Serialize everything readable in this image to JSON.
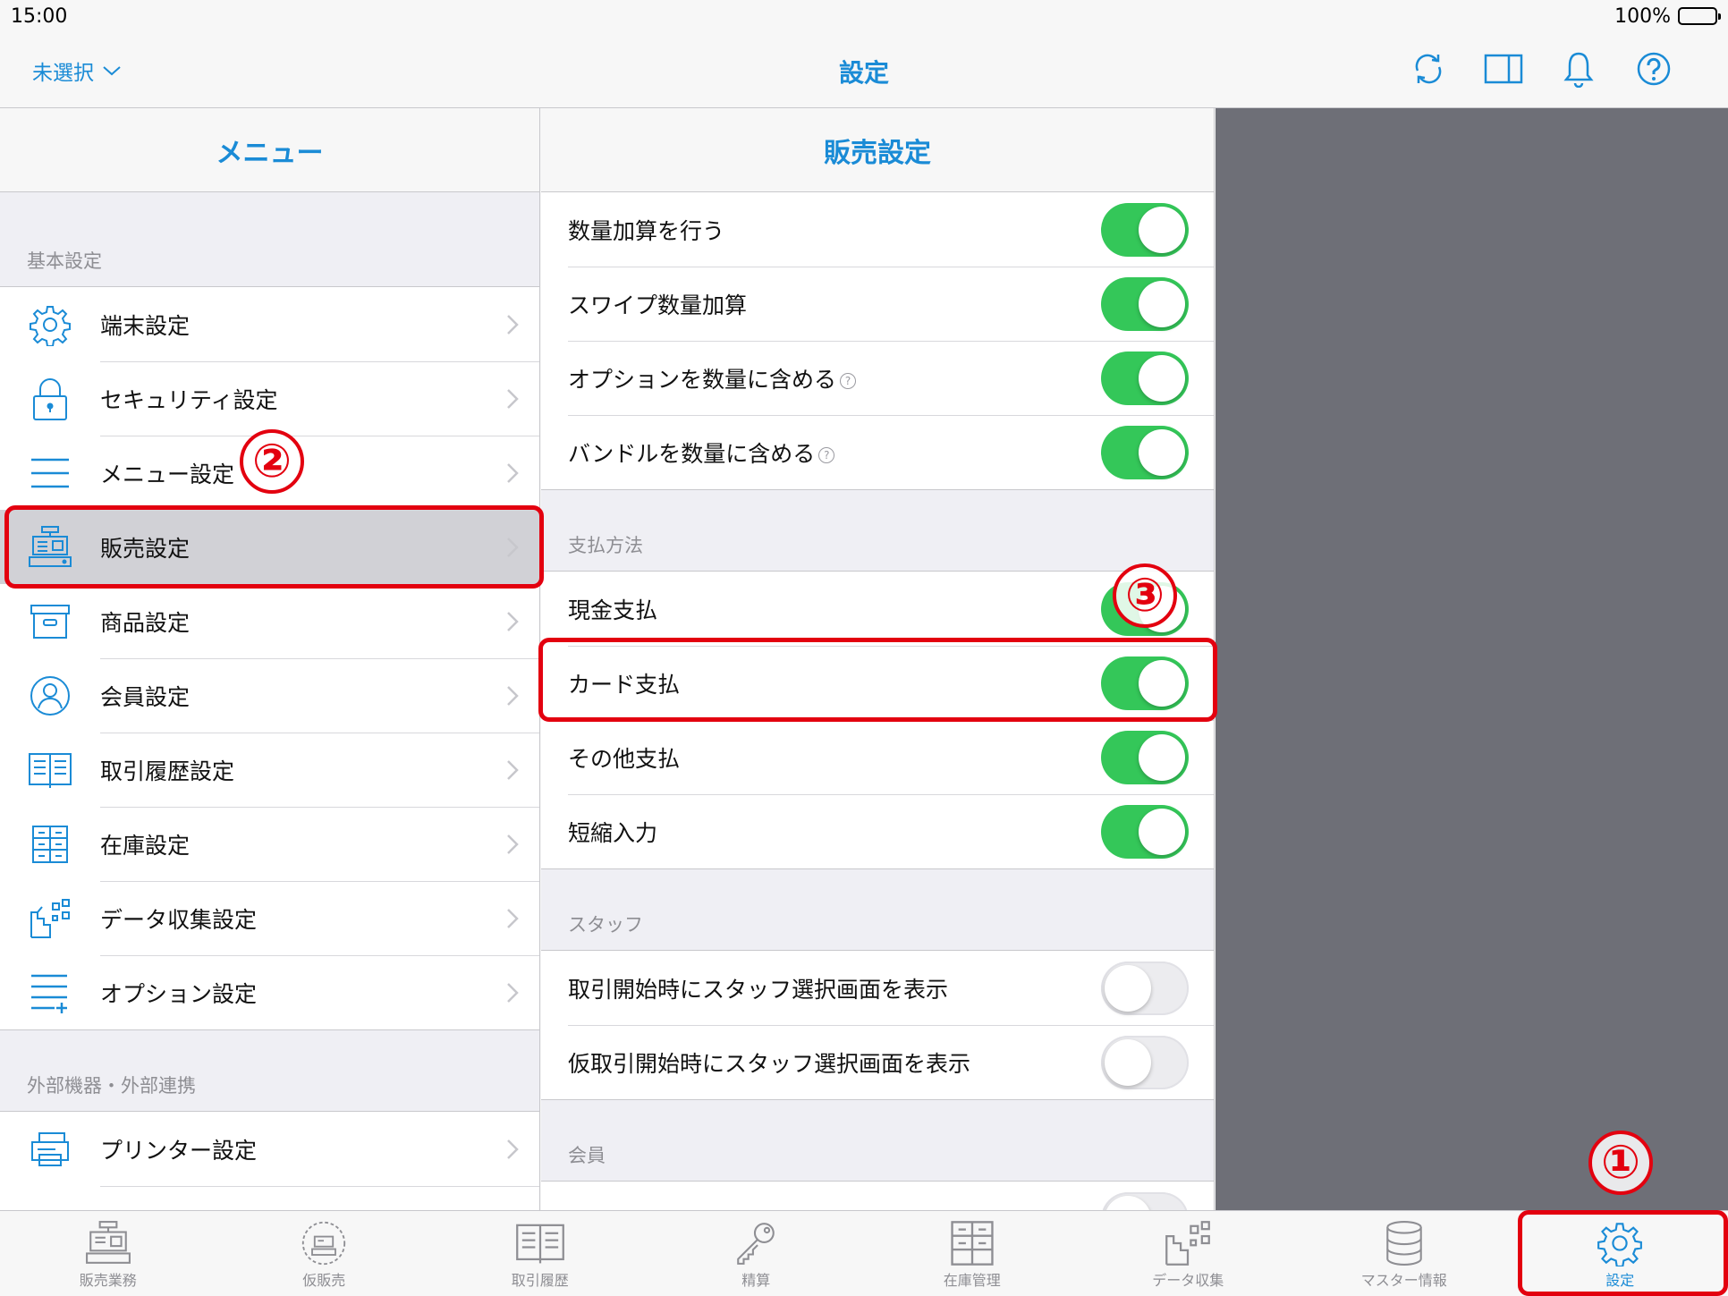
{
  "status_bar": {
    "time": "15:00",
    "battery": "100%"
  },
  "nav_bar": {
    "left_label": "未選択",
    "title": "設定",
    "icons": [
      "refresh-icon",
      "split-view-icon",
      "bell-icon",
      "help-icon"
    ]
  },
  "menu": {
    "title": "メニュー",
    "sections": [
      {
        "header": "基本設定",
        "items": [
          {
            "label": "端末設定",
            "icon": "gear-icon"
          },
          {
            "label": "セキュリティ設定",
            "icon": "lock-icon"
          },
          {
            "label": "メニュー設定",
            "icon": "list-icon"
          },
          {
            "label": "販売設定",
            "icon": "register-icon"
          },
          {
            "label": "商品設定",
            "icon": "box-icon"
          },
          {
            "label": "会員設定",
            "icon": "person-icon"
          },
          {
            "label": "取引履歴設定",
            "icon": "book-icon"
          },
          {
            "label": "在庫設定",
            "icon": "cabinet-icon"
          },
          {
            "label": "データ収集設定",
            "icon": "data-collect-icon"
          },
          {
            "label": "オプション設定",
            "icon": "list-plus-icon"
          }
        ]
      },
      {
        "header": "外部機器・外部連携",
        "items": [
          {
            "label": "プリンター設定",
            "icon": "printer-icon"
          }
        ]
      }
    ]
  },
  "detail": {
    "title": "販売設定",
    "groups": [
      {
        "header": "",
        "rows": [
          {
            "label": "数量加算を行う",
            "on": true,
            "help": false
          },
          {
            "label": "スワイプ数量加算",
            "on": true,
            "help": false
          },
          {
            "label": "オプションを数量に含める",
            "on": true,
            "help": true
          },
          {
            "label": "バンドルを数量に含める",
            "on": true,
            "help": true
          }
        ]
      },
      {
        "header": "支払方法",
        "rows": [
          {
            "label": "現金支払",
            "on": true,
            "help": false
          },
          {
            "label": "カード支払",
            "on": true,
            "help": false
          },
          {
            "label": "その他支払",
            "on": true,
            "help": false
          },
          {
            "label": "短縮入力",
            "on": true,
            "help": false
          }
        ]
      },
      {
        "header": "スタッフ",
        "rows": [
          {
            "label": "取引開始時にスタッフ選択画面を表示",
            "on": false,
            "help": false
          },
          {
            "label": "仮取引開始時にスタッフ選択画面を表示",
            "on": false,
            "help": false
          }
        ]
      },
      {
        "header": "会員",
        "rows": []
      }
    ]
  },
  "tab_bar": {
    "tabs": [
      {
        "label": "販売業務",
        "icon": "register-icon"
      },
      {
        "label": "仮販売",
        "icon": "temp-register-icon"
      },
      {
        "label": "取引履歴",
        "icon": "book-icon"
      },
      {
        "label": "精算",
        "icon": "key-icon"
      },
      {
        "label": "在庫管理",
        "icon": "cabinet-icon"
      },
      {
        "label": "データ収集",
        "icon": "data-collect-icon"
      },
      {
        "label": "マスター情報",
        "icon": "database-icon"
      },
      {
        "label": "設定",
        "icon": "gear-icon"
      }
    ],
    "active": "設定"
  },
  "annotations": [
    "①",
    "②",
    "③"
  ],
  "colors": {
    "accent": "#1a8bd6",
    "toggle_on": "#34c759",
    "annotation": "#e3000f",
    "empty_panel": "#6e6f77"
  }
}
